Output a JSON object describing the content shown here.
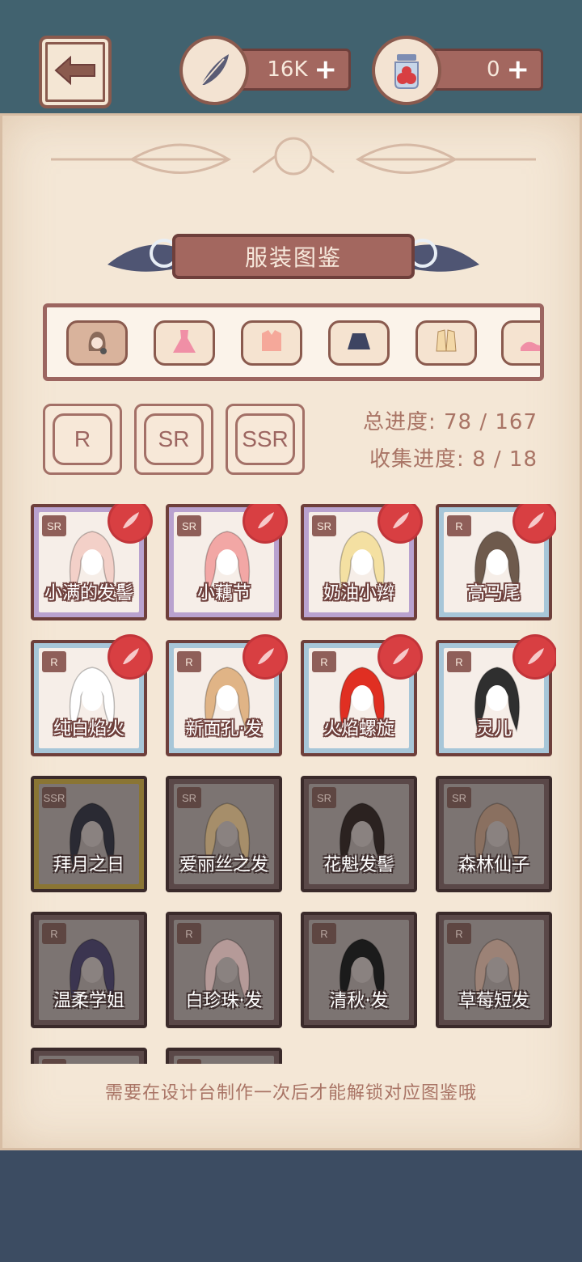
{
  "currencies": [
    {
      "icon": "feather-icon",
      "value": "16K"
    },
    {
      "icon": "apple-jar-icon",
      "value": "0"
    }
  ],
  "title": "服装图鉴",
  "tabs": [
    {
      "icon": "hair-icon",
      "active": true
    },
    {
      "icon": "dress-icon",
      "active": false
    },
    {
      "icon": "top-icon",
      "active": false
    },
    {
      "icon": "skirt-icon",
      "active": false
    },
    {
      "icon": "jacket-icon",
      "active": false
    },
    {
      "icon": "shoes-icon",
      "active": false
    }
  ],
  "rarity_filters": [
    "R",
    "SR",
    "SSR"
  ],
  "progress": {
    "total_label": "总进度: 78 / 167",
    "collect_label": "收集进度: 8 / 18"
  },
  "items": [
    {
      "name": "小满的发髻",
      "rarity": "SR",
      "unlocked": true,
      "seal": true,
      "hair_color": "#f3d0c8"
    },
    {
      "name": "小藕节",
      "rarity": "SR",
      "unlocked": true,
      "seal": true,
      "hair_color": "#f2a7a5"
    },
    {
      "name": "奶油小辫",
      "rarity": "SR",
      "unlocked": true,
      "seal": true,
      "hair_color": "#f4e0a2"
    },
    {
      "name": "高马尾",
      "rarity": "R",
      "unlocked": true,
      "seal": true,
      "hair_color": "#6e5a4c"
    },
    {
      "name": "纯白焰火",
      "rarity": "R",
      "unlocked": true,
      "seal": true,
      "hair_color": "#ffffff"
    },
    {
      "name": "新面孔·发",
      "rarity": "R",
      "unlocked": true,
      "seal": true,
      "hair_color": "#e0b486"
    },
    {
      "name": "火焰螺旋",
      "rarity": "R",
      "unlocked": true,
      "seal": true,
      "hair_color": "#e02f22"
    },
    {
      "name": "灵儿",
      "rarity": "R",
      "unlocked": true,
      "seal": true,
      "hair_color": "#2f2f2f"
    },
    {
      "name": "拜月之日",
      "rarity": "SSR",
      "unlocked": false,
      "seal": false,
      "hair_color": "#2a2a33"
    },
    {
      "name": "爱丽丝之发",
      "rarity": "SR",
      "unlocked": false,
      "seal": false,
      "hair_color": "#a68e6a"
    },
    {
      "name": "花魁发髻",
      "rarity": "SR",
      "unlocked": false,
      "seal": false,
      "hair_color": "#2b2220"
    },
    {
      "name": "森林仙子",
      "rarity": "SR",
      "unlocked": false,
      "seal": false,
      "hair_color": "#8a7060"
    },
    {
      "name": "温柔学姐",
      "rarity": "R",
      "unlocked": false,
      "seal": false,
      "hair_color": "#3b3550"
    },
    {
      "name": "白珍珠·发",
      "rarity": "R",
      "unlocked": false,
      "seal": false,
      "hair_color": "#b59a98"
    },
    {
      "name": "清秋·发",
      "rarity": "R",
      "unlocked": false,
      "seal": false,
      "hair_color": "#1b1b1b"
    },
    {
      "name": "草莓短发",
      "rarity": "R",
      "unlocked": false,
      "seal": false,
      "hair_color": "#9c8276"
    },
    {
      "name": "",
      "rarity": "R",
      "unlocked": false,
      "seal": false,
      "hair_color": "#7c7472"
    },
    {
      "name": "",
      "rarity": "R",
      "unlocked": false,
      "seal": false,
      "hair_color": "#7c7472"
    }
  ],
  "hint": "需要在设计台制作一次后才能解锁对应图鉴哦"
}
